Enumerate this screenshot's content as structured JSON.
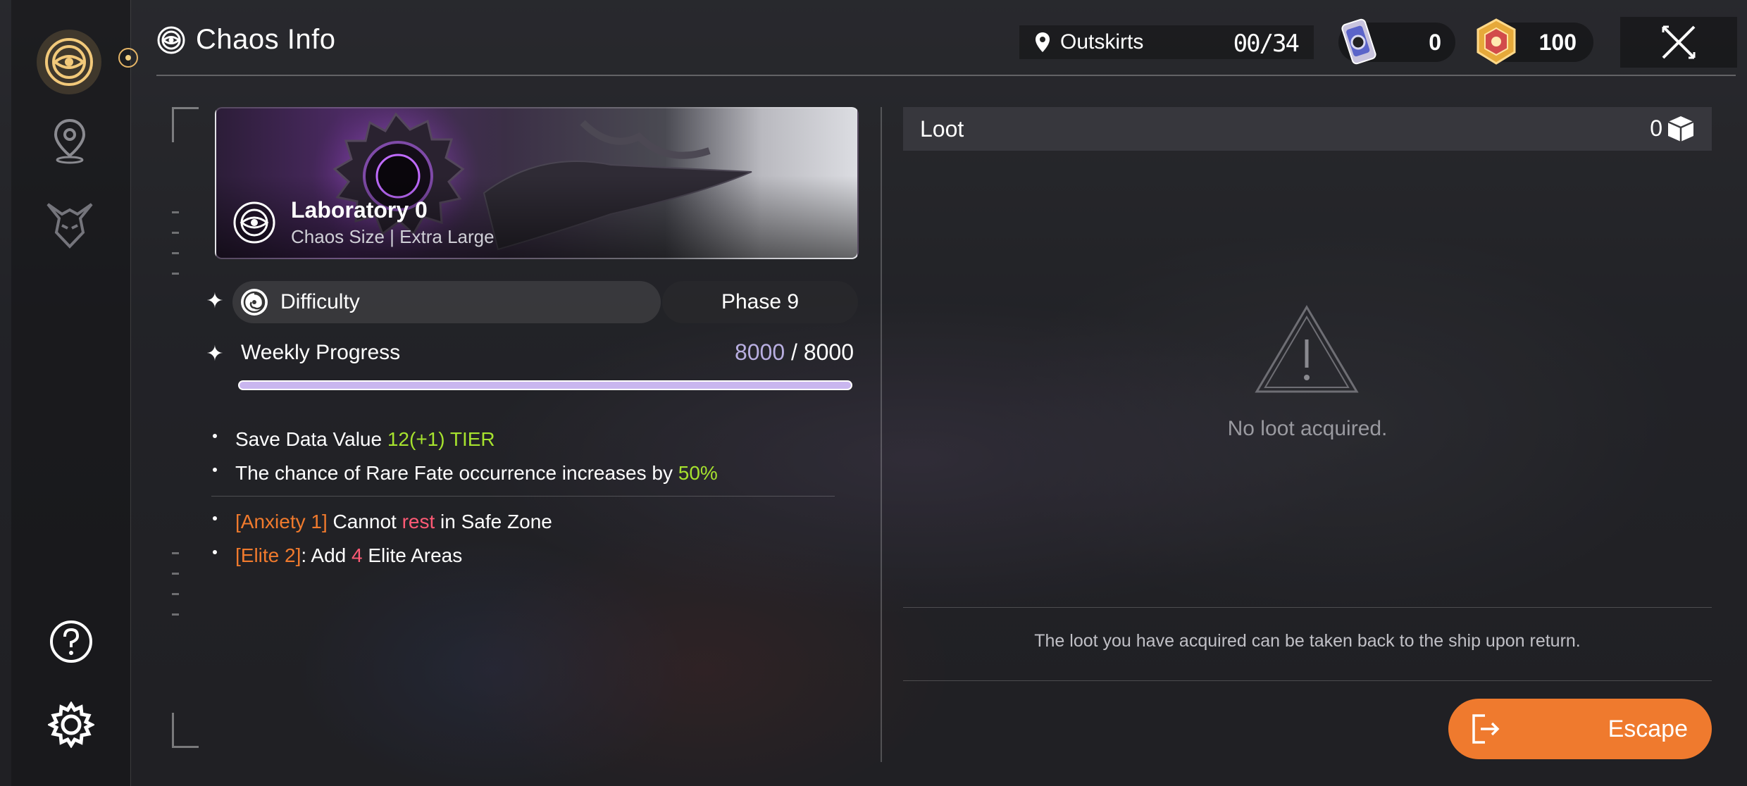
{
  "header": {
    "title": "Chaos Info",
    "location": {
      "name": "Outskirts",
      "count": "00/34"
    },
    "currencies": [
      {
        "icon": "crystal-ticket-icon",
        "value": "0"
      },
      {
        "icon": "gold-emblem-icon",
        "value": "100"
      }
    ]
  },
  "chaos": {
    "name": "Laboratory 0",
    "size_text": "Chaos Size | Extra Large",
    "difficulty_label": "Difficulty",
    "phase": "Phase 9",
    "weekly_label": "Weekly Progress",
    "weekly_current": "8000",
    "weekly_sep": " / ",
    "weekly_max": "8000",
    "weekly_progress": 1.0
  },
  "effects": {
    "save_prefix": "Save Data Value ",
    "save_value": "12(+1) TIER",
    "rare_prefix": "The chance of Rare Fate occurrence increases by ",
    "rare_value": "50%",
    "anxiety_tag": "[Anxiety 1]",
    "anxiety_pre": " Cannot ",
    "anxiety_word": "rest",
    "anxiety_post": " in Safe Zone",
    "elite_tag": "[Elite 2]",
    "elite_pre": ": Add ",
    "elite_num": "4",
    "elite_post": " Elite Areas"
  },
  "loot": {
    "title": "Loot",
    "count": "0",
    "empty_text": "No loot acquired.",
    "note": "The loot you have acquired can be taken back to the ship upon return."
  },
  "escape_label": "Escape",
  "colors": {
    "accent_orange": "#ef7a2e",
    "green": "#a6e22e",
    "red": "#ff5a75",
    "progress": "#c9b6ef"
  }
}
